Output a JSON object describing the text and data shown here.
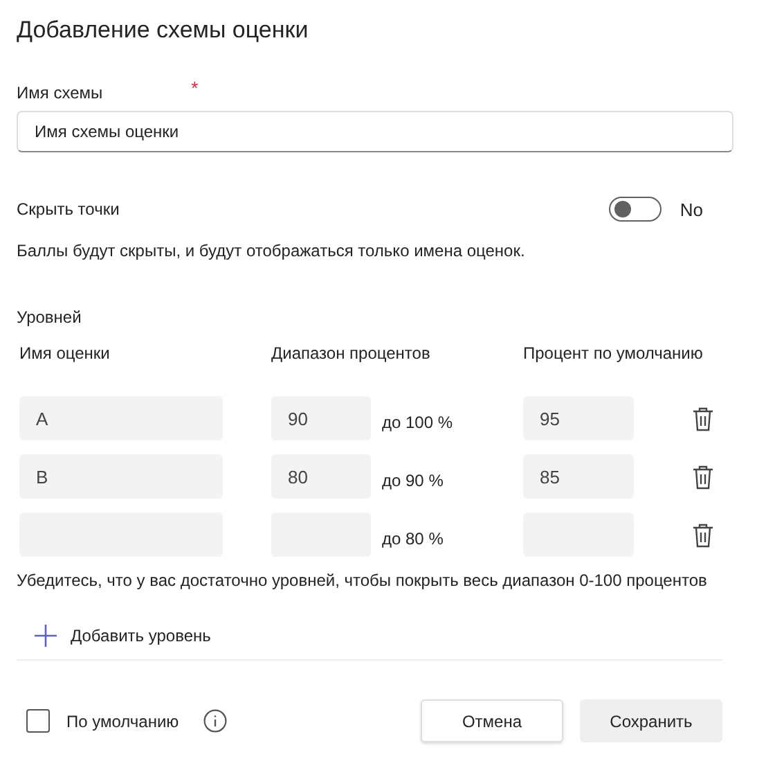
{
  "title": "Добавление схемы оценки",
  "scheme_name": {
    "label": "Имя схемы",
    "required_mark": "*",
    "placeholder": "Имя схемы оценки"
  },
  "hide_points": {
    "label": "Скрыть точки",
    "on": false,
    "state_text": "No",
    "note": "Баллы будут скрыты, и будут отображаться только имена оценок."
  },
  "levels": {
    "title": "Уровней",
    "columns": [
      "Имя оценки",
      "Диапазон процентов",
      "Процент по умолчанию"
    ],
    "rows": [
      {
        "name": "A",
        "from": "90",
        "to": "до 100 %",
        "default": "95"
      },
      {
        "name": "B",
        "from": "80",
        "to": "до 90 %",
        "default": "85"
      },
      {
        "to": "до 80 %"
      }
    ],
    "note": "Убедитесь, что у вас достаточно уровней, чтобы покрыть весь диапазон 0-100 процентов",
    "add": "Добавить уровень"
  },
  "footer": {
    "default_label": "По умолчанию",
    "default_checked": false,
    "cancel": "Отмена",
    "save": "Сохранить"
  }
}
